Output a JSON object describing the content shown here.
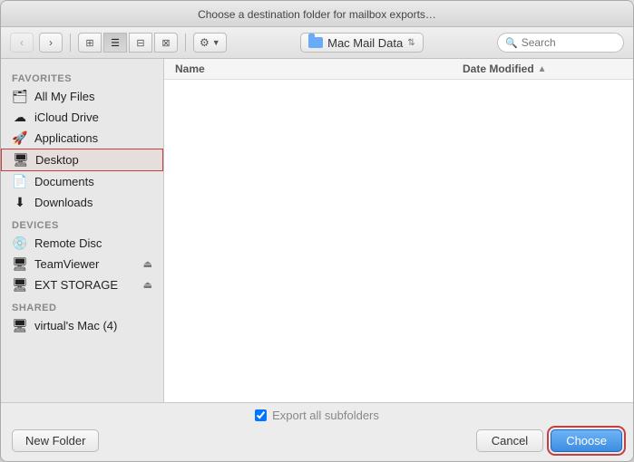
{
  "dialog": {
    "title": "Choose a destination folder for mailbox exports…",
    "folder_name": "Mac Mail Data",
    "search_placeholder": "Search"
  },
  "toolbar": {
    "back_label": "‹",
    "forward_label": "›",
    "view_icons": [
      "⊞",
      "☰",
      "⊟",
      "⊠"
    ],
    "action_label": "⋮"
  },
  "sidebar": {
    "sections": [
      {
        "label": "Favorites",
        "items": [
          {
            "id": "all-my-files",
            "icon": "🗂",
            "label": "All My Files",
            "active": false
          },
          {
            "id": "icloud-drive",
            "icon": "☁",
            "label": "iCloud Drive",
            "active": false
          },
          {
            "id": "applications",
            "icon": "🚀",
            "label": "Applications",
            "active": false
          },
          {
            "id": "desktop",
            "icon": "🖥",
            "label": "Desktop",
            "active": true
          },
          {
            "id": "documents",
            "icon": "📄",
            "label": "Documents",
            "active": false
          },
          {
            "id": "downloads",
            "icon": "⬇",
            "label": "Downloads",
            "active": false
          }
        ]
      },
      {
        "label": "Devices",
        "items": [
          {
            "id": "remote-disc",
            "icon": "💿",
            "label": "Remote Disc",
            "active": false,
            "eject": false
          },
          {
            "id": "teamviewer",
            "icon": "🖥",
            "label": "TeamViewer",
            "active": false,
            "eject": true
          },
          {
            "id": "ext-storage",
            "icon": "🖥",
            "label": "EXT STORAGE",
            "active": false,
            "eject": true
          }
        ]
      },
      {
        "label": "Shared",
        "items": [
          {
            "id": "virtuals-mac",
            "icon": "🖥",
            "label": "virtual's Mac (4)",
            "active": false
          }
        ]
      }
    ]
  },
  "file_list": {
    "col_name": "Name",
    "col_date": "Date Modified",
    "rows": []
  },
  "footer": {
    "checkbox_label": "Export all subfolders",
    "checkbox_checked": true,
    "new_folder_label": "New Folder",
    "cancel_label": "Cancel",
    "choose_label": "Choose"
  }
}
